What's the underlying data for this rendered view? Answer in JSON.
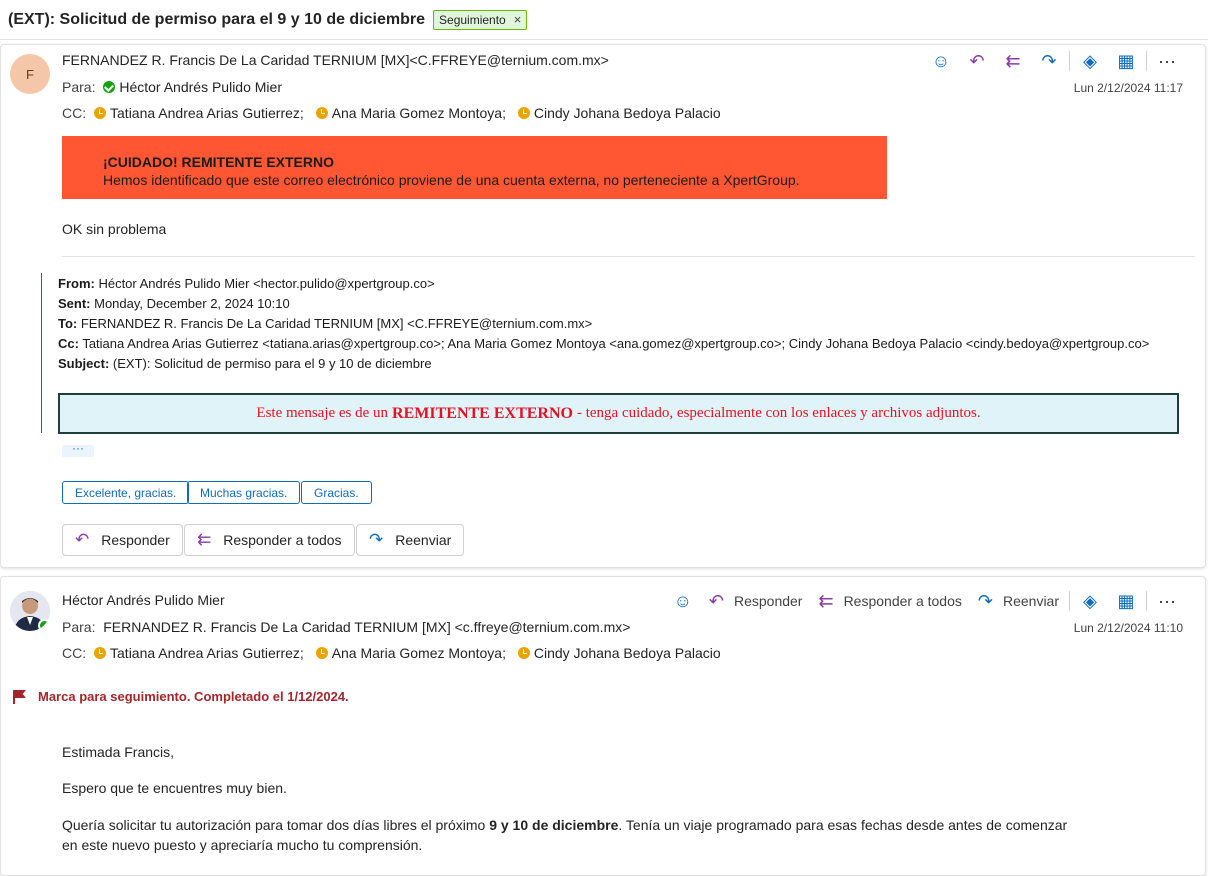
{
  "subject": "(EXT):  Solicitud de permiso para el 9 y 10 de diciembre",
  "tag": {
    "label": "Seguimiento",
    "close": "×"
  },
  "msg1": {
    "avatar_initial": "F",
    "from": "FERNANDEZ R. Francis De La Caridad TERNIUM [MX]<C.FFREYE@ternium.com.mx>",
    "to_label": "Para:",
    "to": "Héctor Andrés Pulido Mier",
    "cc_label": "CC:",
    "cc": [
      "Tatiana Andrea Arias Gutierrez;",
      "Ana Maria Gomez Montoya;",
      "Cindy Johana Bedoya Palacio"
    ],
    "date": "Lun 2/12/2024 11:17",
    "warning_title": "¡CUIDADO! REMITENTE EXTERNO",
    "warning_text": "Hemos identificado que este correo electrónico proviene de una cuenta externa, no perteneciente a XpertGroup.",
    "body": "OK sin problema",
    "quoted": {
      "from_label": "From:",
      "from": " Héctor Andrés Pulido Mier <hector.pulido@xpertgroup.co>",
      "sent_label": "Sent:",
      "sent": " Monday, December 2, 2024 10:10",
      "to_label": "To:",
      "to": " FERNANDEZ R. Francis De La Caridad TERNIUM [MX] <C.FFREYE@ternium.com.mx>",
      "cc_label": "Cc:",
      "cc": " Tatiana Andrea Arias Gutierrez <tatiana.arias@xpertgroup.co>; Ana Maria Gomez Montoya <ana.gomez@xpertgroup.co>; Cindy Johana Bedoya Palacio <cindy.bedoya@xpertgroup.co>",
      "subject_label": "Subject:",
      "subject": " (EXT): Solicitud de permiso para el 9 y 10 de diciembre"
    },
    "ext_banner": {
      "pre": "Este mensaje es de un",
      "strong": "REMITENTE EXTERNO",
      "post": "- tenga cuidado, especialmente con los enlaces y archivos adjuntos."
    },
    "dots": "···",
    "quick_replies": [
      "Excelente, gracias.",
      "Muchas gracias.",
      "Gracias."
    ],
    "buttons": {
      "reply": "Responder",
      "reply_all": "Responder a todos",
      "forward": "Reenviar"
    }
  },
  "msg2": {
    "from": "Héctor Andrés Pulido Mier",
    "to_label": "Para:",
    "to": "FERNANDEZ R. Francis De La Caridad TERNIUM [MX] <c.ffreye@ternium.com.mx>",
    "cc_label": "CC:",
    "cc": [
      "Tatiana Andrea Arias Gutierrez;",
      "Ana Maria Gomez Montoya;",
      "Cindy Johana Bedoya Palacio"
    ],
    "date": "Lun 2/12/2024 11:10",
    "actions": {
      "reply": "Responder",
      "reply_all": "Responder a todos",
      "forward": "Reenviar"
    },
    "flag_text": "Marca para seguimiento. Completado el 1/12/2024.",
    "greeting": "Estimada Francis,",
    "p1": "Espero que te encuentres muy bien.",
    "p2_pre": "Quería solicitar tu autorización para tomar dos días libres el próximo ",
    "p2_bold": "9 y 10 de diciembre",
    "p2_post": ". Tenía un viaje programado para esas fechas desde antes de comenzar",
    "p2_line2": "en este nuevo puesto y apreciaría mucho tu comprensión."
  },
  "colors": {
    "accent": "#0f6cbd",
    "warning_bg": "#ff5733",
    "flag": "#a4262c",
    "purple": "#8a3ba4"
  }
}
